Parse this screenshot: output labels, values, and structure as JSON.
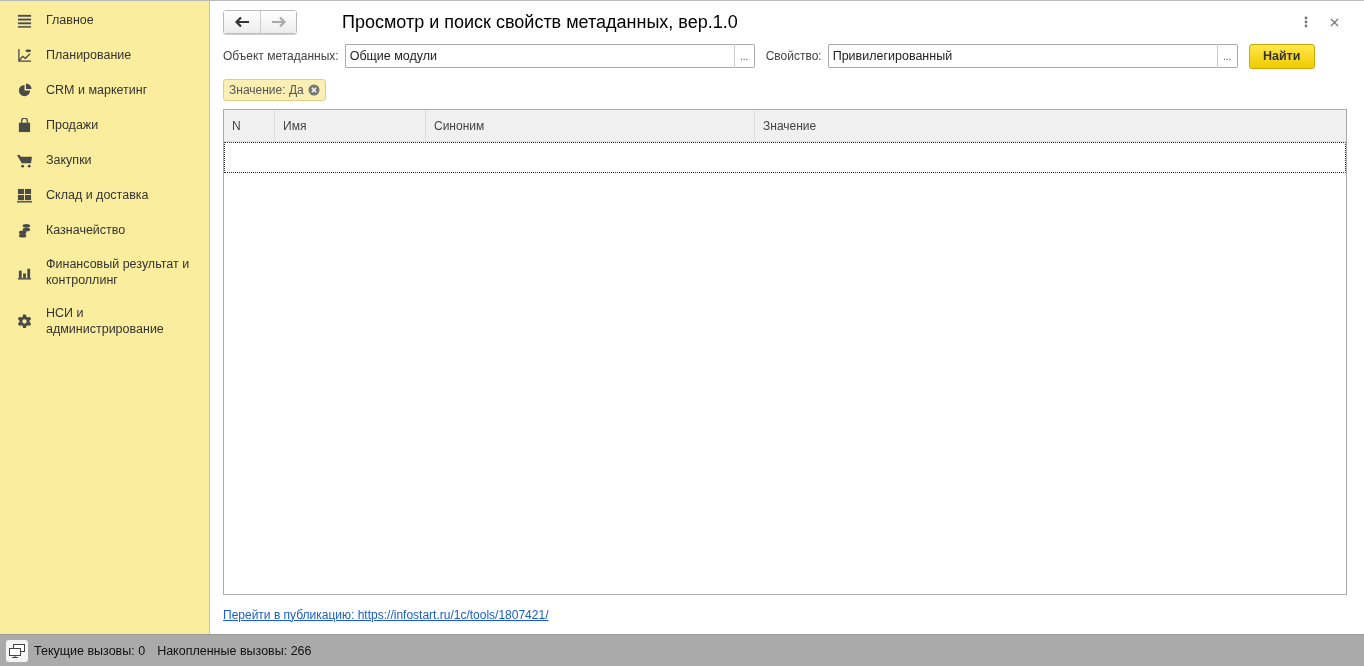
{
  "sidebar": {
    "items": [
      {
        "label": "Главное",
        "kind": "menu"
      },
      {
        "label": "Планирование",
        "kind": "planning"
      },
      {
        "label": "CRM и маркетинг",
        "kind": "pie"
      },
      {
        "label": "Продажи",
        "kind": "bag"
      },
      {
        "label": "Закупки",
        "kind": "cart"
      },
      {
        "label": "Склад и доставка",
        "kind": "grid"
      },
      {
        "label": "Казначейство",
        "kind": "coins"
      },
      {
        "label": "Финансовый результат и контроллинг",
        "kind": "bars"
      },
      {
        "label": "НСИ и администрирование",
        "kind": "gear"
      }
    ]
  },
  "window": {
    "title": "Просмотр и поиск свойств метаданных, вер.1.0"
  },
  "form": {
    "object_label": "Объект метаданных:",
    "object_value": "Общие модули",
    "property_label": "Свойство:",
    "property_value": "Привилегированный",
    "choose_button": "...",
    "find_button": "Найти"
  },
  "filter_tag": "Значение: Да",
  "table": {
    "columns": [
      "N",
      "Имя",
      "Синоним",
      "Значение"
    ]
  },
  "link": "Перейти в публикацию: https://infostart.ru/1c/tools/1807421/",
  "status_bar": {
    "current_calls": "Текущие вызовы: 0",
    "accumulated_calls": "Накопленные вызовы: 266"
  }
}
